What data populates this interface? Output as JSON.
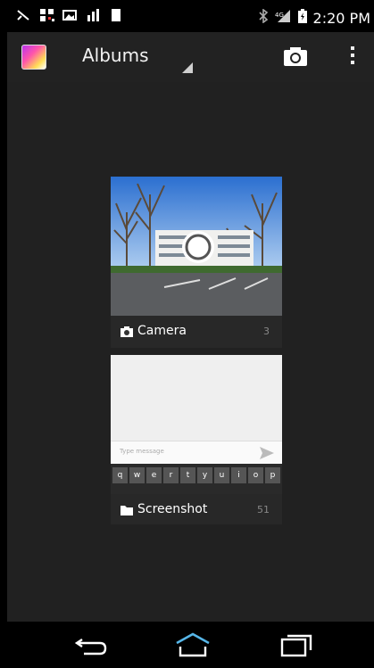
{
  "status_bar": {
    "time": "2:20 PM",
    "icons": [
      "missed-call-icon",
      "qr-icon",
      "photo-icon",
      "signal-bars-icon",
      "notification-icon",
      "bluetooth-icon",
      "signal-icon",
      "battery-icon"
    ]
  },
  "action_bar": {
    "title": "Albums",
    "icons": [
      "app-gallery-icon",
      "spinner-dropdown-icon",
      "camera-icon",
      "overflow-menu-icon"
    ]
  },
  "albums": [
    {
      "name": "Camera",
      "count": "3",
      "icon": "camera-icon"
    },
    {
      "name": "Screenshot",
      "count": "51",
      "icon": "folder-icon"
    }
  ],
  "screenshot_preview": {
    "placeholder": "Type message",
    "keys": [
      "q",
      "w",
      "e",
      "r",
      "t",
      "y",
      "u",
      "i",
      "o",
      "p"
    ]
  },
  "nav_bar": {
    "icons": [
      "back-icon",
      "home-icon",
      "recent-apps-icon"
    ]
  },
  "colors": {
    "background": "#212121",
    "status_bar": "#000000",
    "tile_label": "#282828",
    "text": "#ffffff"
  }
}
